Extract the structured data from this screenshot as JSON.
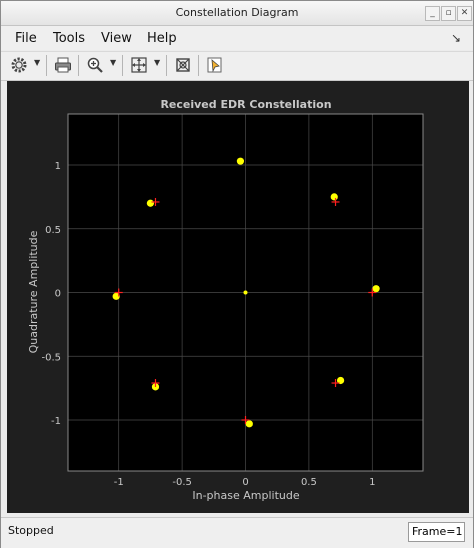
{
  "window": {
    "title": "Constellation Diagram"
  },
  "menu": {
    "file": "File",
    "tools": "Tools",
    "view": "View",
    "help": "Help"
  },
  "toolbar": {
    "icons": [
      "gear-icon",
      "print-icon",
      "zoom-in-icon",
      "fit-view-icon",
      "autoscale-icon",
      "highlight-icon"
    ]
  },
  "status": {
    "text": "Stopped",
    "frame": "Frame=1"
  },
  "chart_data": {
    "type": "scatter",
    "title": "Received EDR Constellation",
    "xlabel": "In-phase Amplitude",
    "ylabel": "Quadrature Amplitude",
    "xlim": [
      -1.4,
      1.4
    ],
    "ylim": [
      -1.4,
      1.4
    ],
    "x_ticks": [
      "-1",
      "-0.5",
      "0",
      "0.5",
      "1"
    ],
    "y_ticks": [
      "1",
      "0.5",
      "0",
      "-0.5",
      "-1"
    ],
    "grid": true,
    "colors": {
      "background": "#000000",
      "grid": "#4a4a4a",
      "received": "#ffff00",
      "reference": "#ff2020",
      "text": "#c8c8c8"
    },
    "series": [
      {
        "marker": "dot",
        "color": "#ffff00",
        "points": [
          [
            -0.04,
            1.03
          ],
          [
            0.7,
            0.75
          ],
          [
            1.03,
            0.03
          ],
          [
            0.75,
            -0.69
          ],
          [
            0.03,
            -1.03
          ],
          [
            -0.71,
            -0.74
          ],
          [
            -1.02,
            -0.03
          ],
          [
            -0.75,
            0.7
          ],
          [
            0.0,
            0.0
          ]
        ]
      },
      {
        "marker": "plus",
        "color": "#ff2020",
        "points": [
          [
            0.71,
            0.71
          ],
          [
            1.0,
            0.0
          ],
          [
            0.71,
            -0.71
          ],
          [
            0.0,
            -1.0
          ],
          [
            -0.71,
            -0.71
          ],
          [
            -1.0,
            0.0
          ],
          [
            -0.71,
            0.71
          ]
        ]
      }
    ]
  }
}
